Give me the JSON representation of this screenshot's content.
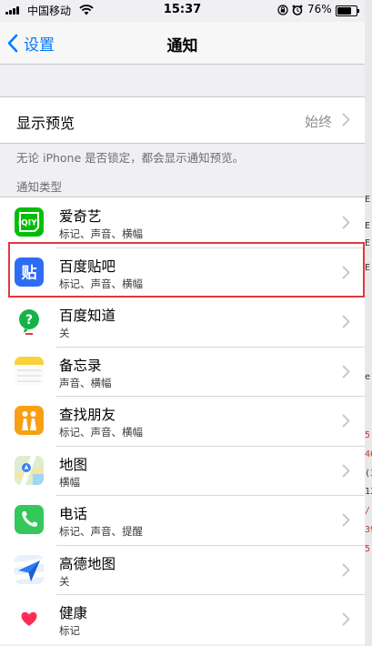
{
  "status_bar": {
    "carrier": "中国移动",
    "time": "15:37",
    "battery": "76%"
  },
  "nav": {
    "back_label": "设置",
    "title": "通知"
  },
  "preview": {
    "label": "显示预览",
    "value": "始终"
  },
  "footnote": "无论 iPhone 是否锁定，都会显示通知预览。",
  "section_header": "通知类型",
  "apps": [
    {
      "name": "爱奇艺",
      "detail": "标记、声音、横幅",
      "icon": "iqiyi-icon"
    },
    {
      "name": "百度贴吧",
      "detail": "标记、声音、横幅",
      "icon": "baidu-tieba-icon"
    },
    {
      "name": "百度知道",
      "detail": "关",
      "icon": "baidu-zhidao-icon"
    },
    {
      "name": "备忘录",
      "detail": "声音、横幅",
      "icon": "notes-icon"
    },
    {
      "name": "查找朋友",
      "detail": "标记、声音、横幅",
      "icon": "find-friends-icon"
    },
    {
      "name": "地图",
      "detail": "横幅",
      "icon": "maps-icon"
    },
    {
      "name": "电话",
      "detail": "标记、声音、提醒",
      "icon": "phone-icon"
    },
    {
      "name": "高德地图",
      "detail": "关",
      "icon": "amap-icon"
    },
    {
      "name": "健康",
      "detail": "标记",
      "icon": "health-icon"
    }
  ],
  "highlighted_item": "百度贴吧",
  "colors": {
    "ios_blue": "#007aff",
    "highlight_red": "#e0393e",
    "iqiyi_green": "#00be06",
    "tieba_blue": "#2f6cf6",
    "zhidao_green": "#17b247",
    "notes_yellow": "#f8d33b",
    "find_friends_orange": "#f7a014",
    "phone_green": "#34c759"
  },
  "edge_fragments": [
    "E",
    "E",
    "E",
    "E",
    "e",
    "5(",
    "46",
    "(3",
    "13",
    "/",
    "39",
    "5"
  ]
}
